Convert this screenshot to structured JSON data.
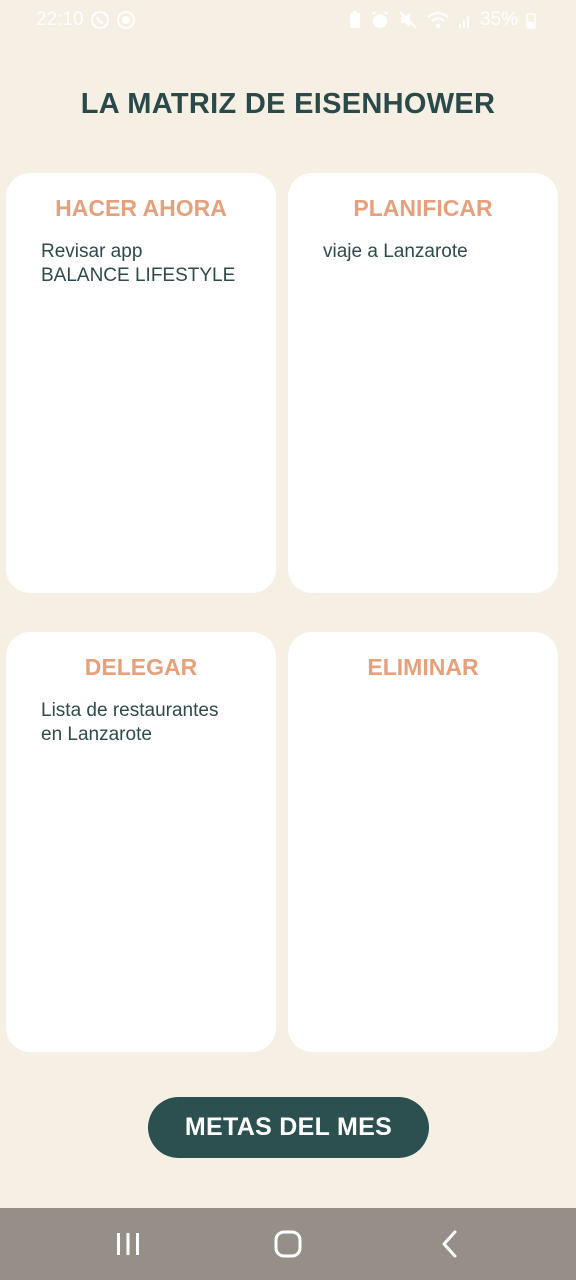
{
  "status_bar": {
    "time": "22:10",
    "battery": "35%",
    "left_icons": [
      "whatsapp-icon",
      "record-icon"
    ],
    "right_icons": [
      "battery-saver-icon",
      "alarm-icon",
      "mute-icon",
      "wifi-icon",
      "signal-icon",
      "battery-icon"
    ]
  },
  "header": {
    "title": "LA MATRIZ DE EISENHOWER"
  },
  "quadrants": [
    {
      "title": "HACER AHORA",
      "content": "Revisar app\nBALANCE LIFESTYLE"
    },
    {
      "title": "PLANIFICAR",
      "content": "viaje a Lanzarote"
    },
    {
      "title": "DELEGAR",
      "content": "Lista de restaurantes\nen Lanzarote"
    },
    {
      "title": "ELIMINAR",
      "content": ""
    }
  ],
  "footer": {
    "goals_button_label": "METAS DEL MES"
  },
  "nav": {
    "icons": [
      "recents-icon",
      "home-icon",
      "back-icon"
    ]
  },
  "colors": {
    "background": "#f6efe4",
    "card": "#ffffff",
    "title_text": "#2a4a4a",
    "quadrant_title": "#e6a07c",
    "button": "#2c4f4f",
    "nav_bar": "#958f88"
  }
}
